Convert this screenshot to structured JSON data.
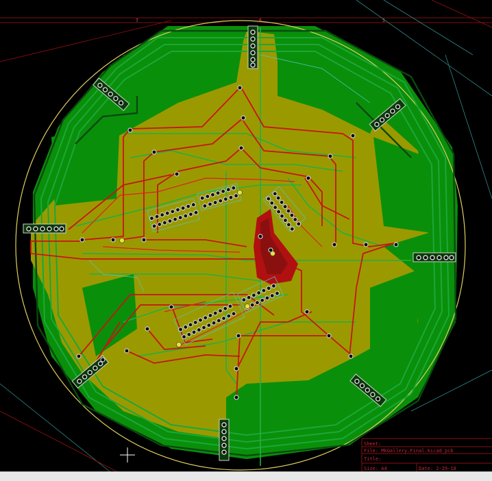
{
  "board": {
    "colors": {
      "background": "#000000",
      "outer_zone": "#008a00",
      "fill_zone": "#9a9a00",
      "front_copper": "#c81414",
      "back_copper": "#1a9a3a",
      "edge_cuts": "#e0d060",
      "frame": "#8a1010",
      "silkscreen": "#40c0c0",
      "pad_ring": "#d8d8d8"
    }
  },
  "ruler": {
    "labels": [
      "7",
      "6",
      "5"
    ]
  },
  "title_block": {
    "sheet_label": "Sheet:",
    "file_label": "File: MkGallery.Final.kicad_pcb",
    "title_label": "Title:",
    "size_label": "Size: A4",
    "date_label": "Date: 2-29-18"
  },
  "status_bar": {
    "text": ""
  }
}
